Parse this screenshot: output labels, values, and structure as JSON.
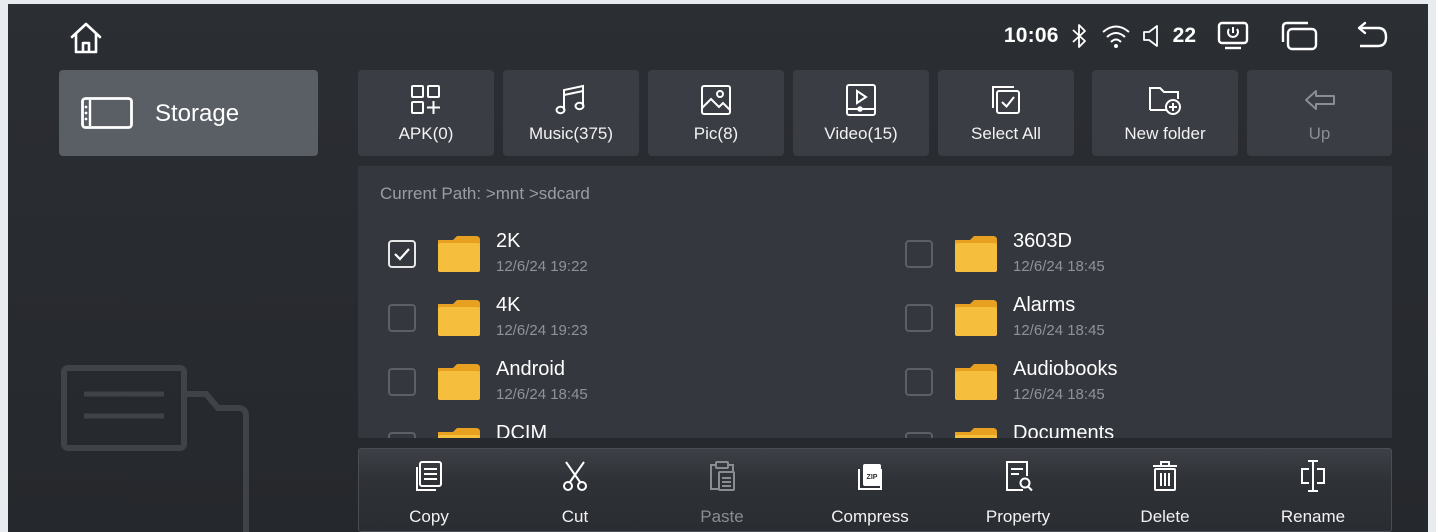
{
  "status_bar": {
    "time": "10:06",
    "volume": "22",
    "icons": [
      "home-icon",
      "bluetooth-icon",
      "wifi-icon",
      "volume-icon",
      "screen-power-icon",
      "window-icon",
      "back-icon"
    ]
  },
  "sidebar": {
    "storage_label": "Storage"
  },
  "toolbar": {
    "apk": "APK(0)",
    "music": "Music(375)",
    "pic": "Pic(8)",
    "video": "Video(15)",
    "select_all": "Select All",
    "new_folder": "New folder",
    "up": "Up"
  },
  "panel": {
    "current_path": "Current Path: >mnt >sdcard",
    "items": [
      {
        "name": "2K",
        "date": "12/6/24 19:22",
        "checked": true
      },
      {
        "name": "3603D",
        "date": "12/6/24 18:45",
        "checked": false
      },
      {
        "name": "4K",
        "date": "12/6/24 19:23",
        "checked": false
      },
      {
        "name": "Alarms",
        "date": "12/6/24 18:45",
        "checked": false
      },
      {
        "name": "Android",
        "date": "12/6/24 18:45",
        "checked": false
      },
      {
        "name": "Audiobooks",
        "date": "12/6/24 18:45",
        "checked": false
      },
      {
        "name": "DCIM",
        "date": "",
        "checked": false
      },
      {
        "name": "Documents",
        "date": "",
        "checked": false
      }
    ]
  },
  "bottom_bar": {
    "copy": "Copy",
    "cut": "Cut",
    "paste": "Paste",
    "compress": "Compress",
    "property": "Property",
    "delete": "Delete",
    "rename": "Rename"
  },
  "colors": {
    "background": "#2b2e33",
    "tile": "#3a3d43",
    "selected_tab": "#5a5e65",
    "folder": "#f2b52e"
  }
}
